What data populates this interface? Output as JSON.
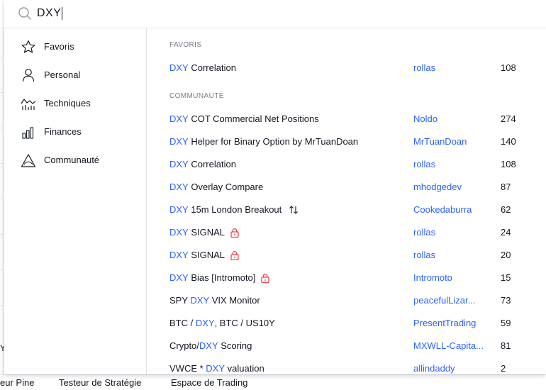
{
  "search": {
    "value": "DXY"
  },
  "sidebar": {
    "items": [
      {
        "label": "Favoris",
        "icon": "star-icon"
      },
      {
        "label": "Personal",
        "icon": "person-icon"
      },
      {
        "label": "Techniques",
        "icon": "techniques-icon"
      },
      {
        "label": "Finances",
        "icon": "finances-icon"
      },
      {
        "label": "Communauté",
        "icon": "community-icon"
      }
    ]
  },
  "sections": {
    "favorites": {
      "title": "FAVORIS",
      "rows": [
        {
          "pre": "",
          "hl": "DXY",
          "post": " Correlation",
          "author": "rollas",
          "count": "108",
          "icon": ""
        }
      ]
    },
    "community": {
      "title": "COMMUNAUTÉ",
      "rows": [
        {
          "pre": "",
          "hl": "DXY",
          "post": " COT Commercial Net Positions",
          "author": "Noldo",
          "count": "274",
          "icon": ""
        },
        {
          "pre": "",
          "hl": "DXY",
          "post": " Helper for Binary Option by MrTuanDoan",
          "author": "MrTuanDoan",
          "count": "140",
          "icon": ""
        },
        {
          "pre": "",
          "hl": "DXY",
          "post": " Correlation",
          "author": "rollas",
          "count": "108",
          "icon": ""
        },
        {
          "pre": "",
          "hl": "DXY",
          "post": " Overlay Compare",
          "author": "mhodgedev",
          "count": "87",
          "icon": ""
        },
        {
          "pre": "",
          "hl": "DXY",
          "post": " 15m London Breakout",
          "author": "Cookedaburra",
          "count": "62",
          "icon": "strategy-icon"
        },
        {
          "pre": "",
          "hl": "DXY",
          "post": " SIGNAL",
          "author": "rollas",
          "count": "24",
          "icon": "lock-icon"
        },
        {
          "pre": "",
          "hl": "DXY",
          "post": " SIGNAL",
          "author": "rollas",
          "count": "20",
          "icon": "lock-icon"
        },
        {
          "pre": "",
          "hl": "DXY",
          "post": " Bias [Intromoto]",
          "author": "Intromoto",
          "count": "15",
          "icon": "lock-icon"
        },
        {
          "pre": "SPY ",
          "hl": "DXY",
          "post": " VIX Monitor",
          "author": "peacefulLizar...",
          "count": "73",
          "icon": ""
        },
        {
          "pre": "BTC / ",
          "hl": "DXY",
          "post": ", BTC / US10Y",
          "author": "PresentTrading",
          "count": "59",
          "icon": ""
        },
        {
          "pre": "Crypto/",
          "hl": "DXY",
          "post": " Scoring",
          "author": "MXWLL-Capita...",
          "count": "81",
          "icon": ""
        },
        {
          "pre": "VWCE * ",
          "hl": "DXY",
          "post": " valuation",
          "author": "allindaddy",
          "count": "2",
          "icon": ""
        }
      ]
    }
  },
  "background": {
    "stub": "Y",
    "footer_tabs": [
      "eur Pine",
      "Testeur de Stratégie",
      "Espace de Trading"
    ]
  },
  "colors": {
    "accent": "#2962ff",
    "text": "#131722",
    "muted": "#787b86",
    "lock": "#f23645"
  }
}
